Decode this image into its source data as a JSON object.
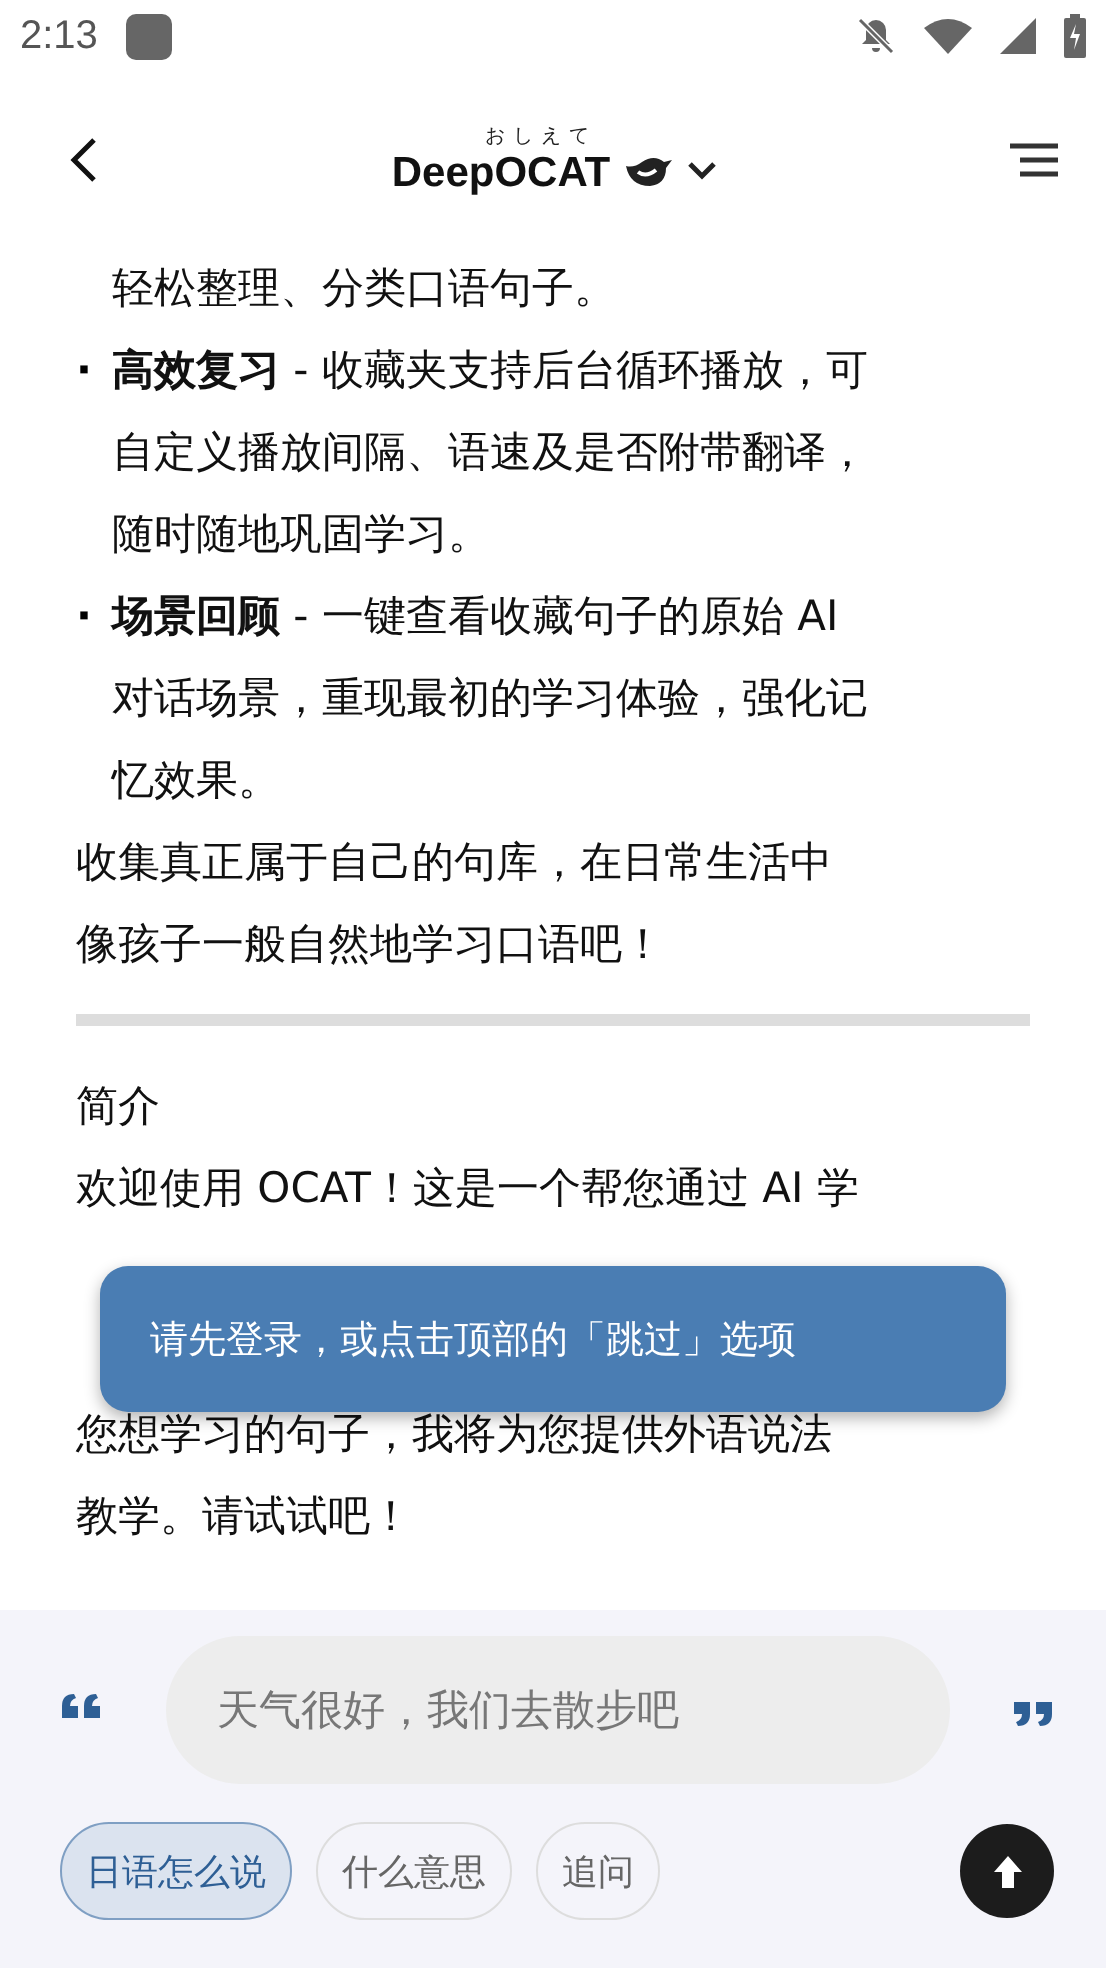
{
  "status_bar": {
    "time": "2:13"
  },
  "header": {
    "ruby": "おしえて",
    "title": "DeepOCAT"
  },
  "content": [
    {
      "kind": "bullet_tail",
      "lines": [
        "轻松整理、分类口语句子。"
      ]
    },
    {
      "kind": "bullet",
      "mark": "·",
      "lines": [
        "**高效复习** - 收藏夹支持后台循环播放，可",
        "自定义播放间隔、语速及是否附带翻译，",
        "随时随地巩固学习。"
      ]
    },
    {
      "kind": "bullet",
      "mark": "·",
      "lines": [
        "**场景回顾** - 一键查看收藏句子的原始 AI",
        "对话场景，重现最初的学习体验，强化记",
        "忆效果。"
      ]
    },
    {
      "kind": "paragraph",
      "lines": [
        "收集真正属于自己的句库，在日常生活中",
        "像孩子一般自然地学习口语吧！"
      ]
    },
    {
      "kind": "divider"
    },
    {
      "kind": "heading",
      "lines": [
        "简介"
      ]
    },
    {
      "kind": "paragraph",
      "lines": [
        "欢迎使用 OCAT！这是一个帮您通过 AI 学"
      ]
    },
    {
      "kind": "covered"
    },
    {
      "kind": "paragraph",
      "lines": [
        "您想学习的句子，我将为您提供外语说法",
        "教学。请试试吧！"
      ]
    }
  ],
  "toast": "请先登录，或点击顶部的「跳过」选项",
  "input": {
    "placeholder": "天气很好，我们去散步吧"
  },
  "chips": [
    {
      "label": "日语怎么说",
      "selected": true
    },
    {
      "label": "什么意思",
      "selected": false
    },
    {
      "label": "追问",
      "selected": false
    }
  ]
}
